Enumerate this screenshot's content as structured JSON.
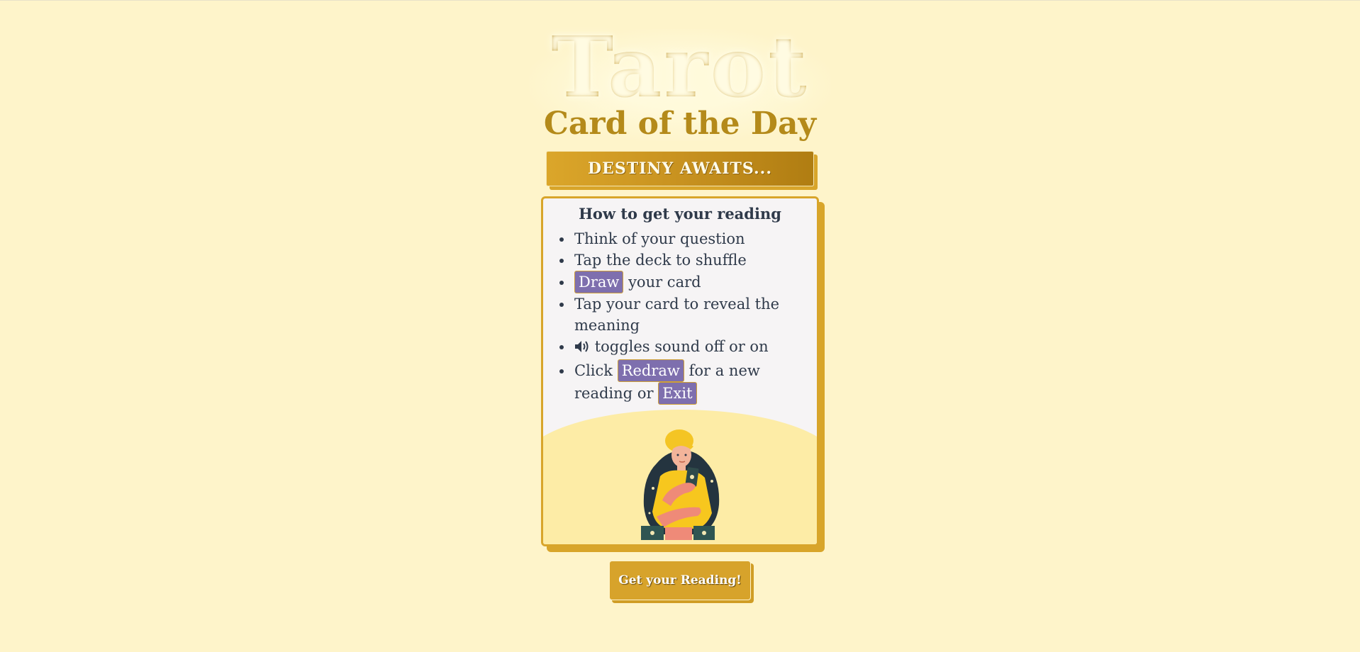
{
  "header": {
    "title": "Tarot",
    "subtitle": "Card of the Day"
  },
  "banner": {
    "text": "DESTINY AWAITS..."
  },
  "instructions": {
    "heading": "How to get your reading",
    "step1": "Think of your question",
    "step2": "Tap the deck to shuffle",
    "step3_chip": "Draw",
    "step3_rest": "your card",
    "step4": "Tap your card to reveal the meaning",
    "step5_icon": "speaker-icon",
    "step5_rest": "toggles sound off or on",
    "step6_pre": "Click",
    "step6_chip1": "Redraw",
    "step6_mid": "for a new reading",
    "step6_or": "or",
    "step6_chip2": "Exit"
  },
  "illustration": {
    "icon": "fortune-teller-illustration"
  },
  "cta": {
    "label": "Get your Reading!"
  },
  "colors": {
    "background": "#fef4ca",
    "gold": "#d8a52a",
    "chip": "#7e6fae",
    "text": "#2f3a4a"
  }
}
